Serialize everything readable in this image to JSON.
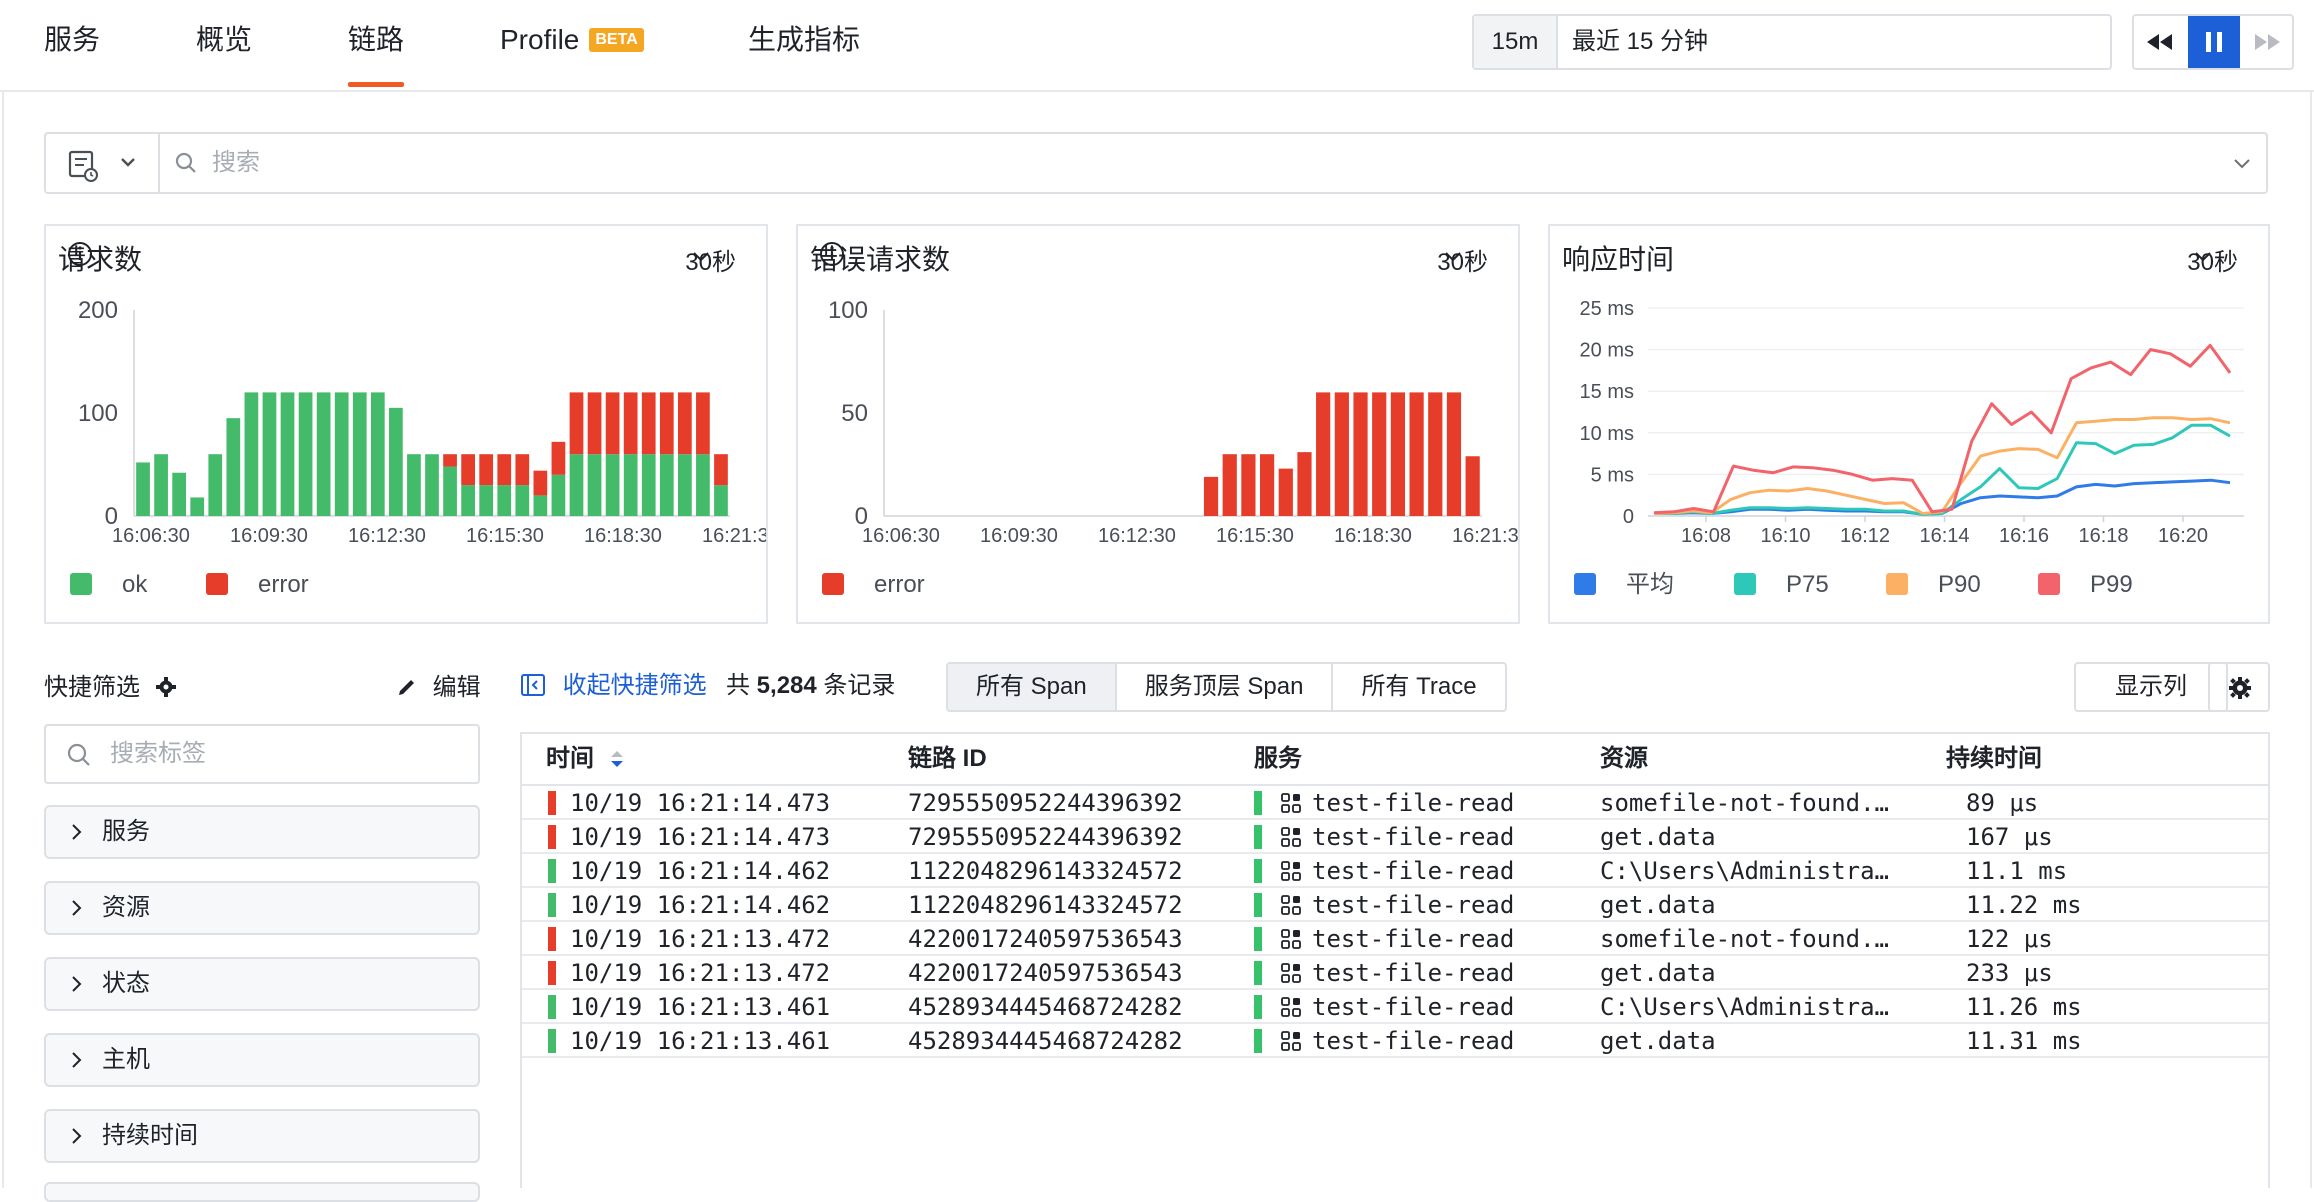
{
  "colors": {
    "accent": "#f05a24",
    "primary": "#1d5fd6",
    "ok": "#44bb6a",
    "error": "#e63c2a",
    "avg": "#2f7be8",
    "p75": "#2ec8b9",
    "p90": "#fbb063",
    "p99": "#f2636b"
  },
  "nav": {
    "tabs": [
      "服务",
      "概览",
      "链路",
      "Profile",
      "生成指标"
    ],
    "active_tab": "链路",
    "beta_badge": "BETA"
  },
  "time_picker": {
    "short": "15m",
    "label": "最近 15 分钟"
  },
  "playback": {
    "rewind_icon": "rewind-icon",
    "pause_icon": "pause-icon",
    "forward_icon": "fast-forward-icon"
  },
  "search": {
    "placeholder": "搜索"
  },
  "charts": {
    "requests": {
      "title": "请求数",
      "interval": "30秒",
      "legend": [
        "ok",
        "error"
      ]
    },
    "errors": {
      "title": "错误请求数",
      "interval": "30秒",
      "legend": [
        "error"
      ]
    },
    "latency": {
      "title": "响应时间",
      "interval": "30秒",
      "legend": [
        "平均",
        "P75",
        "P90",
        "P99"
      ]
    }
  },
  "chart_data": [
    {
      "type": "bar",
      "title": "请求数",
      "stacked": true,
      "ylim": [
        0,
        200
      ],
      "yticks": [
        "200",
        "100",
        "0"
      ],
      "xticks": [
        "16:06:30",
        "16:09:30",
        "16:12:30",
        "16:15:30",
        "16:18:30",
        "16:21:3"
      ],
      "legend_position": "bottom-left",
      "series": [
        {
          "name": "ok",
          "values": [
            52,
            60,
            42,
            18,
            60,
            95,
            120,
            120,
            120,
            120,
            120,
            120,
            120,
            120,
            105,
            60,
            60,
            48,
            30,
            30,
            30,
            30,
            20,
            40,
            60,
            60,
            60,
            60,
            60,
            60,
            60,
            60,
            30
          ]
        },
        {
          "name": "error",
          "values": [
            0,
            0,
            0,
            0,
            0,
            0,
            0,
            0,
            0,
            0,
            0,
            0,
            0,
            0,
            0,
            0,
            0,
            12,
            30,
            30,
            30,
            30,
            24,
            32,
            60,
            60,
            60,
            60,
            60,
            60,
            60,
            60,
            30
          ]
        }
      ]
    },
    {
      "type": "bar",
      "title": "错误请求数",
      "ylim": [
        0,
        100
      ],
      "yticks": [
        "100",
        "50",
        "0"
      ],
      "xticks": [
        "16:06:30",
        "16:09:30",
        "16:12:30",
        "16:15:30",
        "16:18:30",
        "16:21:3"
      ],
      "legend_position": "bottom-left",
      "series": [
        {
          "name": "error",
          "values": [
            0,
            0,
            0,
            0,
            0,
            0,
            0,
            0,
            0,
            0,
            0,
            0,
            0,
            0,
            0,
            0,
            0,
            19,
            30,
            30,
            30,
            23,
            31,
            60,
            60,
            60,
            60,
            60,
            60,
            60,
            60,
            29
          ]
        }
      ]
    },
    {
      "type": "line",
      "title": "响应时间",
      "ylim": [
        0,
        25
      ],
      "yticks": [
        "25 ms",
        "20 ms",
        "15 ms",
        "10 ms",
        "5 ms",
        "0"
      ],
      "xticks": [
        "16:08",
        "16:10",
        "16:12",
        "16:14",
        "16:16",
        "16:18",
        "16:20"
      ],
      "legend_position": "bottom-left",
      "series": [
        {
          "name": "平均",
          "values": [
            0.3,
            0.3,
            0.4,
            0.3,
            0.5,
            0.8,
            0.8,
            0.7,
            0.8,
            0.7,
            0.6,
            0.6,
            0.5,
            0.5,
            0.2,
            0.3,
            1.5,
            2.2,
            2.4,
            2.3,
            2.2,
            2.4,
            3.5,
            3.8,
            3.6,
            3.9,
            4.0,
            4.1,
            4.2,
            4.3,
            4.0
          ]
        },
        {
          "name": "P75",
          "values": [
            0.3,
            0.3,
            0.5,
            0.3,
            0.7,
            1.0,
            1.0,
            0.9,
            1.0,
            0.9,
            0.8,
            0.8,
            0.6,
            0.6,
            0.2,
            0.3,
            2.0,
            3.5,
            5.7,
            3.4,
            3.3,
            4.5,
            8.8,
            8.7,
            7.5,
            8.5,
            8.6,
            9.4,
            10.9,
            10.9,
            9.6
          ]
        },
        {
          "name": "P90",
          "values": [
            0.3,
            0.4,
            0.6,
            0.4,
            2.0,
            2.8,
            3.1,
            3.0,
            3.3,
            3.0,
            2.5,
            2.0,
            1.5,
            1.6,
            0.3,
            0.5,
            4.0,
            7.2,
            7.8,
            8.1,
            8.0,
            7.0,
            11.2,
            11.4,
            11.6,
            11.6,
            11.8,
            11.8,
            11.6,
            11.7,
            11.2
          ]
        },
        {
          "name": "P99",
          "values": [
            0.4,
            0.5,
            0.9,
            0.5,
            6.0,
            5.5,
            5.2,
            5.9,
            5.8,
            5.5,
            5.0,
            4.3,
            4.5,
            4.3,
            0.5,
            0.8,
            9.0,
            13.5,
            11.0,
            12.5,
            10.0,
            16.5,
            17.8,
            18.5,
            17.0,
            20.0,
            19.5,
            18.0,
            20.5,
            17.2
          ]
        }
      ]
    }
  ],
  "quick_filter": {
    "title": "快捷筛选",
    "edit_label": "编辑",
    "search_placeholder": "搜索标签",
    "facets": [
      "服务",
      "资源",
      "状态",
      "主机",
      "持续时间"
    ]
  },
  "list_toolbar": {
    "collapse_label": "收起快捷筛选",
    "total_prefix": "共",
    "total_count": "5,284",
    "total_suffix": "条记录",
    "segments": [
      "所有 Span",
      "服务顶层 Span",
      "所有 Trace"
    ],
    "active_segment": "所有 Span",
    "columns_button": "显示列"
  },
  "table": {
    "headers": [
      "时间",
      "链路 ID",
      "服务",
      "资源",
      "持续时间"
    ],
    "rows": [
      {
        "status": "error",
        "time": "10/19 16:21:14.473",
        "trace_id": "7295550952244396392",
        "service": "test-file-read",
        "resource": "somefile-not-found.…",
        "duration": "89 μs"
      },
      {
        "status": "error",
        "time": "10/19 16:21:14.473",
        "trace_id": "7295550952244396392",
        "service": "test-file-read",
        "resource": "get.data",
        "duration": "167 μs"
      },
      {
        "status": "ok",
        "time": "10/19 16:21:14.462",
        "trace_id": "1122048296143324572",
        "service": "test-file-read",
        "resource": "C:\\Users\\Administra…",
        "duration": "11.1 ms"
      },
      {
        "status": "ok",
        "time": "10/19 16:21:14.462",
        "trace_id": "1122048296143324572",
        "service": "test-file-read",
        "resource": "get.data",
        "duration": "11.22 ms"
      },
      {
        "status": "error",
        "time": "10/19 16:21:13.472",
        "trace_id": "4220017240597536543",
        "service": "test-file-read",
        "resource": "somefile-not-found.…",
        "duration": "122 μs"
      },
      {
        "status": "error",
        "time": "10/19 16:21:13.472",
        "trace_id": "4220017240597536543",
        "service": "test-file-read",
        "resource": "get.data",
        "duration": "233 μs"
      },
      {
        "status": "ok",
        "time": "10/19 16:21:13.461",
        "trace_id": "4528934445468724282",
        "service": "test-file-read",
        "resource": "C:\\Users\\Administra…",
        "duration": "11.26 ms"
      },
      {
        "status": "ok",
        "time": "10/19 16:21:13.461",
        "trace_id": "4528934445468724282",
        "service": "test-file-read",
        "resource": "get.data",
        "duration": "11.31 ms"
      }
    ]
  }
}
